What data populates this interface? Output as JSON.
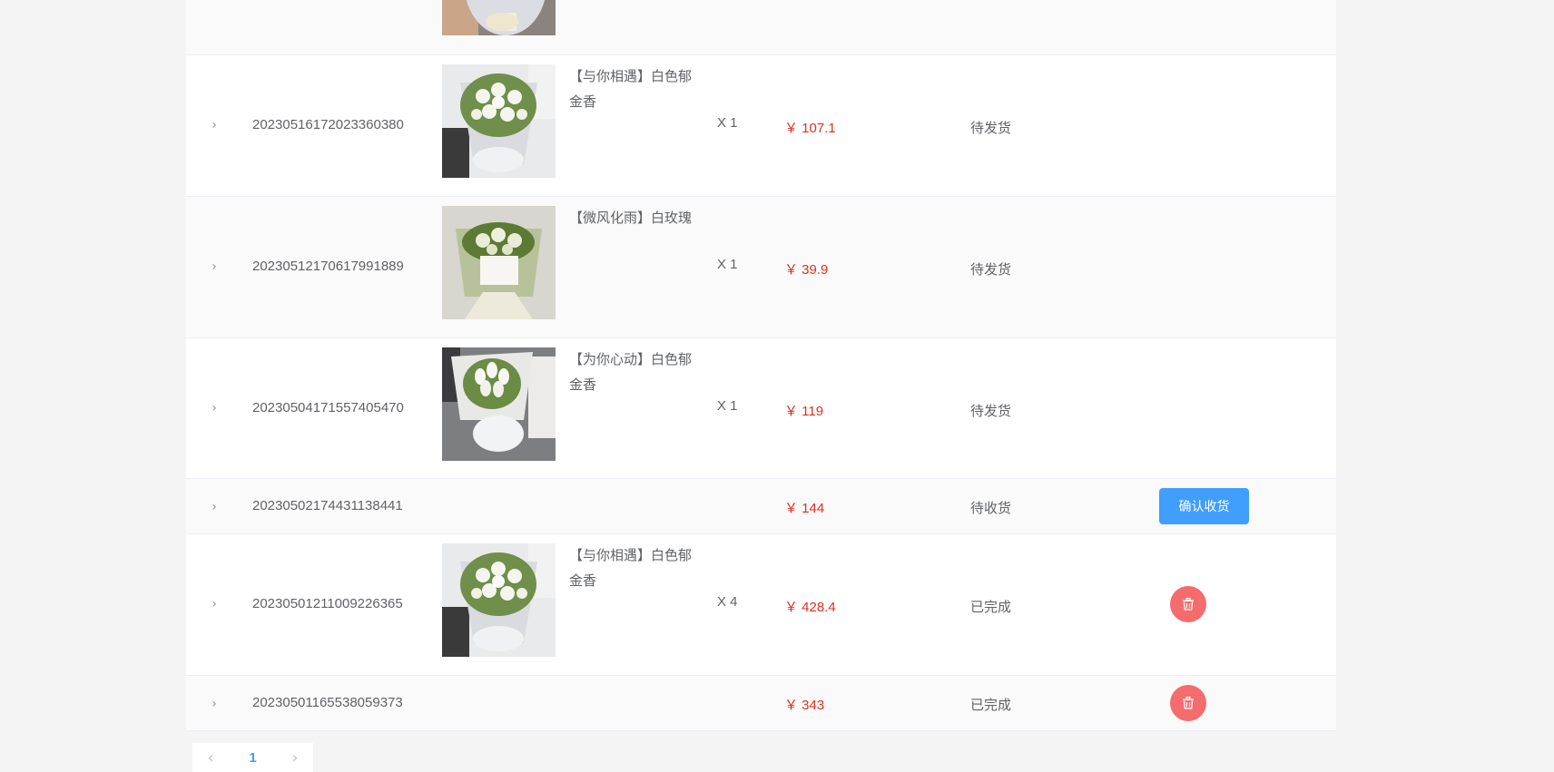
{
  "orders": [
    {
      "order_no": "",
      "product_name": "",
      "quantity": "",
      "price": "",
      "status": "",
      "image": "bouquet-white-tulips-top"
    },
    {
      "order_no": "20230516172023360380",
      "product_name": "【与你相遇】白色郁金香",
      "quantity": "X 1",
      "price": "￥ 107.1",
      "status": "待发货",
      "image": "bouquet-white-tulips"
    },
    {
      "order_no": "20230512170617991889",
      "product_name": "【微风化雨】白玫瑰",
      "quantity": "X 1",
      "price": "￥ 39.9",
      "status": "待发货",
      "image": "bouquet-white-roses"
    },
    {
      "order_no": "20230504171557405470",
      "product_name": "【为你心动】白色郁金香",
      "quantity": "X 1",
      "price": "￥ 119",
      "status": "待发货",
      "image": "bouquet-white-tulips-2"
    },
    {
      "order_no": "20230502174431138441",
      "product_name": "",
      "quantity": "",
      "price": "￥ 144",
      "status": "待收货",
      "action": "确认收货"
    },
    {
      "order_no": "20230501211009226365",
      "product_name": "【与你相遇】白色郁金香",
      "quantity": "X 4",
      "price": "￥ 428.4",
      "status": "已完成",
      "image": "bouquet-white-tulips",
      "action_icon": "trash-icon"
    },
    {
      "order_no": "20230501165538059373",
      "product_name": "",
      "quantity": "",
      "price": "￥ 343",
      "status": "已完成",
      "action_icon": "trash-icon"
    }
  ],
  "icons": {
    "expand": "chevron-right-icon",
    "prev": "chevron-left-icon",
    "next": "chevron-right-icon",
    "delete": "trash-icon"
  },
  "pagination": {
    "current_page": "1",
    "prev_label": "‹",
    "next_label": "›"
  },
  "colors": {
    "price": "#e0301e",
    "primary": "#409eff",
    "danger": "#f56c6c"
  }
}
